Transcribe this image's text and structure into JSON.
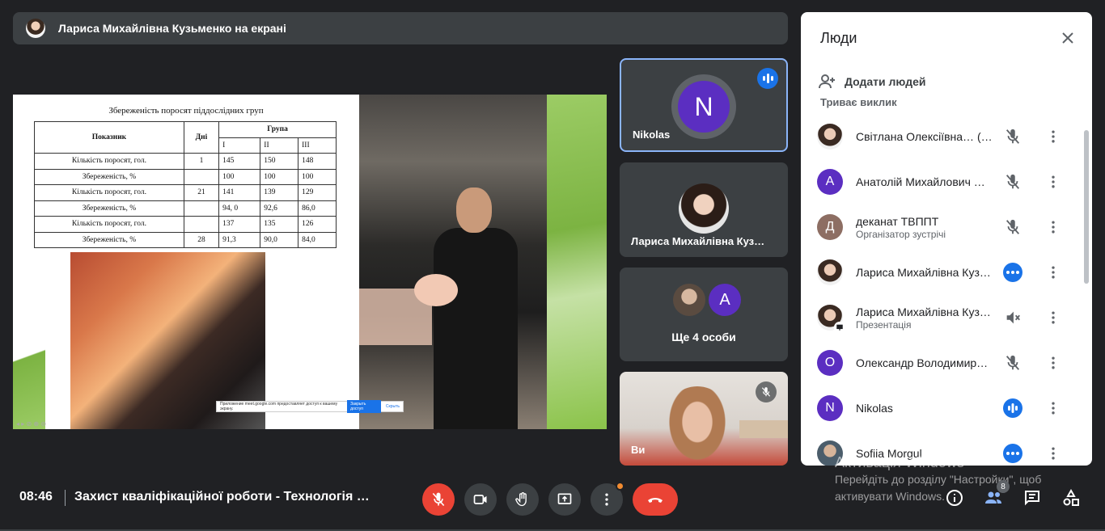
{
  "banner": {
    "text": "Лариса Михайлівна Кузьменко на екрані"
  },
  "slide": {
    "title": "Збереженість поросят піддослідних груп",
    "table": {
      "h_indicator": "Показник",
      "h_days": "Дні",
      "h_group": "Група",
      "groups": [
        "І",
        "ІІ",
        "ІІІ"
      ],
      "rows": [
        [
          "Кількість поросят, гол.",
          "1",
          "145",
          "150",
          "148"
        ],
        [
          "Збереженість, %",
          "",
          "100",
          "100",
          "100"
        ],
        [
          "Кількість поросят, гол.",
          "21",
          "141",
          "139",
          "129"
        ],
        [
          "Збереженість, %",
          "",
          "94, 0",
          "92,6",
          "86,0"
        ],
        [
          "Кількість поросят, гол.",
          "",
          "137",
          "135",
          "126"
        ],
        [
          "Збереженість, %",
          "28",
          "91,3",
          "90,0",
          "84,0"
        ]
      ]
    },
    "share_notice": "Приложение meet.google.com предоставляет доступ к вашему экрану.",
    "share_stop": "Закрыть доступ",
    "share_hide": "Скрыть"
  },
  "tiles": {
    "nikolas": {
      "initial": "N",
      "name": "Nikolas"
    },
    "larysa": {
      "name": "Лариса Михайлівна Куз…"
    },
    "more": {
      "initial": "A",
      "label": "Ще 4 особи"
    },
    "you": {
      "name": "Ви"
    }
  },
  "panel": {
    "title": "Люди",
    "add_people": "Додати людей",
    "section": "Триває виклик",
    "people": [
      {
        "name": "Світлана Олексіївна… (Ви)",
        "sub": "",
        "avatar": "photo",
        "initial": "",
        "color": "",
        "status": "muted"
      },
      {
        "name": "Анатолій Михайлович Ш…",
        "sub": "",
        "avatar": "letter",
        "initial": "А",
        "color": "#5b2ec1",
        "status": "muted"
      },
      {
        "name": "деканат ТВППТ",
        "sub": "Організатор зустрічі",
        "avatar": "letter",
        "initial": "Д",
        "color": "#8d6e63",
        "status": "muted"
      },
      {
        "name": "Лариса Михайлівна Кузь…",
        "sub": "",
        "avatar": "photo",
        "initial": "",
        "color": "",
        "status": "talking-dots"
      },
      {
        "name": "Лариса Михайлівна Кузь…",
        "sub": "Презентація",
        "avatar": "photo-presenting",
        "initial": "",
        "color": "",
        "status": "volume-off"
      },
      {
        "name": "Олександр Володимир…",
        "sub": "",
        "avatar": "letter",
        "initial": "О",
        "color": "#5b2ec1",
        "status": "muted"
      },
      {
        "name": "Nikolas",
        "sub": "",
        "avatar": "letter",
        "initial": "N",
        "color": "#5b2ec1",
        "status": "talking-bars"
      },
      {
        "name": "Sofiia Morgul",
        "sub": "",
        "avatar": "photo2",
        "initial": "",
        "color": "",
        "status": "talking-dots"
      }
    ]
  },
  "bottom": {
    "time": "08:46",
    "meeting_title": "Захист кваліфікаційної роботи - Технологія …",
    "people_count": "8"
  },
  "watermark": {
    "line1": "Активація Windows",
    "line2": "Перейдіть до розділу \"Настройки\", щоб",
    "line3": "активувати Windows."
  },
  "colors": {
    "accent": "#1a73e8",
    "danger": "#ea4335",
    "purple": "#5b2ec1"
  }
}
